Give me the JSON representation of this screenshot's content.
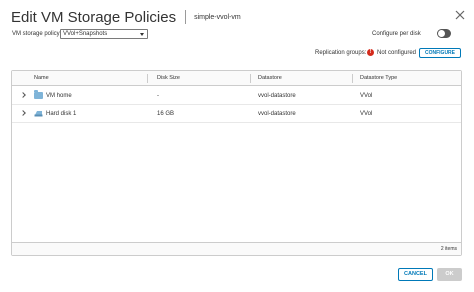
{
  "dialog": {
    "title": "Edit VM Storage Policies",
    "subtitle": "simple-vvol-vm"
  },
  "policy": {
    "label": "VM storage policy",
    "value": "VVol+Snapshots"
  },
  "configure_per_disk": {
    "label": "Configure per disk",
    "enabled": false
  },
  "replication": {
    "label": "Replication groups:",
    "status": "Not configured",
    "button": "CONFIGURE",
    "status_icon": "error-icon"
  },
  "table": {
    "columns": [
      "Name",
      "Disk Size",
      "Datastore",
      "Datastore Type"
    ],
    "rows": [
      {
        "name": "VM home",
        "disk_size": "-",
        "datastore": "vvol-datastore",
        "type": "VVol",
        "icon": "folder-icon"
      },
      {
        "name": "Hard disk 1",
        "disk_size": "16 GB",
        "datastore": "vvol-datastore",
        "type": "VVol",
        "icon": "disk-icon"
      }
    ],
    "footer_count": "2 items"
  },
  "actions": {
    "cancel": "CANCEL",
    "ok": "OK"
  },
  "colors": {
    "accent": "#0079b8",
    "error": "#d42b1c",
    "disabled": "#cccccc"
  }
}
